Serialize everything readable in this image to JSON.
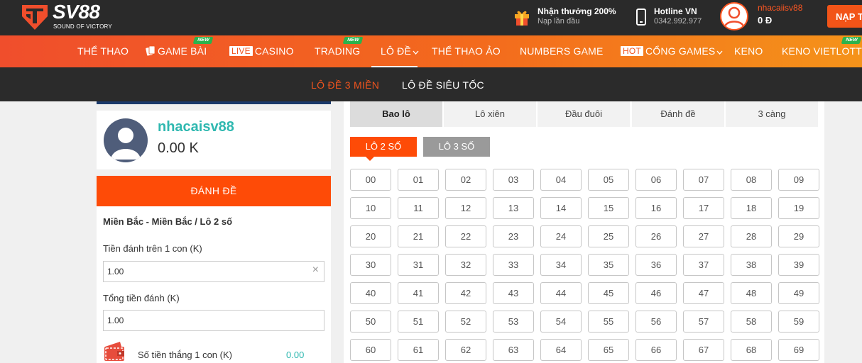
{
  "brand": {
    "name": "SV88",
    "tagline": "SOUND OF VICTORY"
  },
  "header": {
    "promo": {
      "title": "Nhận thưởng 200%",
      "subtitle": "Nạp lần đầu"
    },
    "hotline": {
      "title": "Hotline VN",
      "number": "0342.992.977"
    },
    "user": {
      "name": "nhacaiisv88",
      "balance": "0 Đ"
    },
    "deposit_label": "NẠP T"
  },
  "nav": {
    "items": [
      {
        "label": "THỂ THAO"
      },
      {
        "label": "GAME BÀI",
        "badge": "NEW"
      },
      {
        "label": "CASINO",
        "tag": "LIVE"
      },
      {
        "label": "TRADING",
        "badge": "NEW"
      },
      {
        "label": "LÔ ĐỀ"
      },
      {
        "label": "THỂ THAO ẢO"
      },
      {
        "label": "NUMBERS GAME"
      },
      {
        "label": "CỔNG GAMES",
        "tag": "HOT"
      },
      {
        "label": "KENO"
      },
      {
        "label": "KENO VIETLOTT",
        "badge": "NEW"
      }
    ]
  },
  "subnav": {
    "items": [
      {
        "label": "LÔ ĐỀ 3 MIỀN"
      },
      {
        "label": "LÔ ĐỀ SIÊU TỐC"
      }
    ]
  },
  "profile": {
    "name": "nhacaisv88",
    "balance": "0.00 K"
  },
  "bet": {
    "button": "ĐÁNH ĐỀ",
    "path": "Miền Bắc - Miền Bắc / Lô 2 số",
    "stake_label": "Tiền đánh trên 1 con (K)",
    "stake_value": "1.00",
    "total_label": "Tổng tiền đánh (K)",
    "total_value": "1.00",
    "win_label": "Số tiền thắng 1 con (K)",
    "win_value": "0.00"
  },
  "tabs": [
    "Bao lô",
    "Lô xiên",
    "Đầu đuôi",
    "Đánh đề",
    "3 càng"
  ],
  "modes": [
    "LÔ 2 SỐ",
    "LÔ 3 SỐ"
  ],
  "numbers": [
    "00",
    "01",
    "02",
    "03",
    "04",
    "05",
    "06",
    "07",
    "08",
    "09",
    "10",
    "11",
    "12",
    "13",
    "14",
    "15",
    "16",
    "17",
    "18",
    "19",
    "20",
    "21",
    "22",
    "23",
    "24",
    "25",
    "26",
    "27",
    "28",
    "29",
    "30",
    "31",
    "32",
    "33",
    "34",
    "35",
    "36",
    "37",
    "38",
    "39",
    "40",
    "41",
    "42",
    "43",
    "44",
    "45",
    "46",
    "47",
    "48",
    "49",
    "50",
    "51",
    "52",
    "53",
    "54",
    "55",
    "56",
    "57",
    "58",
    "59",
    "60",
    "61",
    "62",
    "63",
    "64",
    "65",
    "66",
    "67",
    "68",
    "69"
  ],
  "colors": {
    "accent": "#fe4b07",
    "teal": "#2fb8b0",
    "dark": "#2a2a2a"
  },
  "icons": [
    "logo-shield-icon",
    "gift-icon",
    "phone-icon",
    "user-avatar-icon",
    "chevron-down-icon",
    "close-icon",
    "wallet-icon"
  ]
}
